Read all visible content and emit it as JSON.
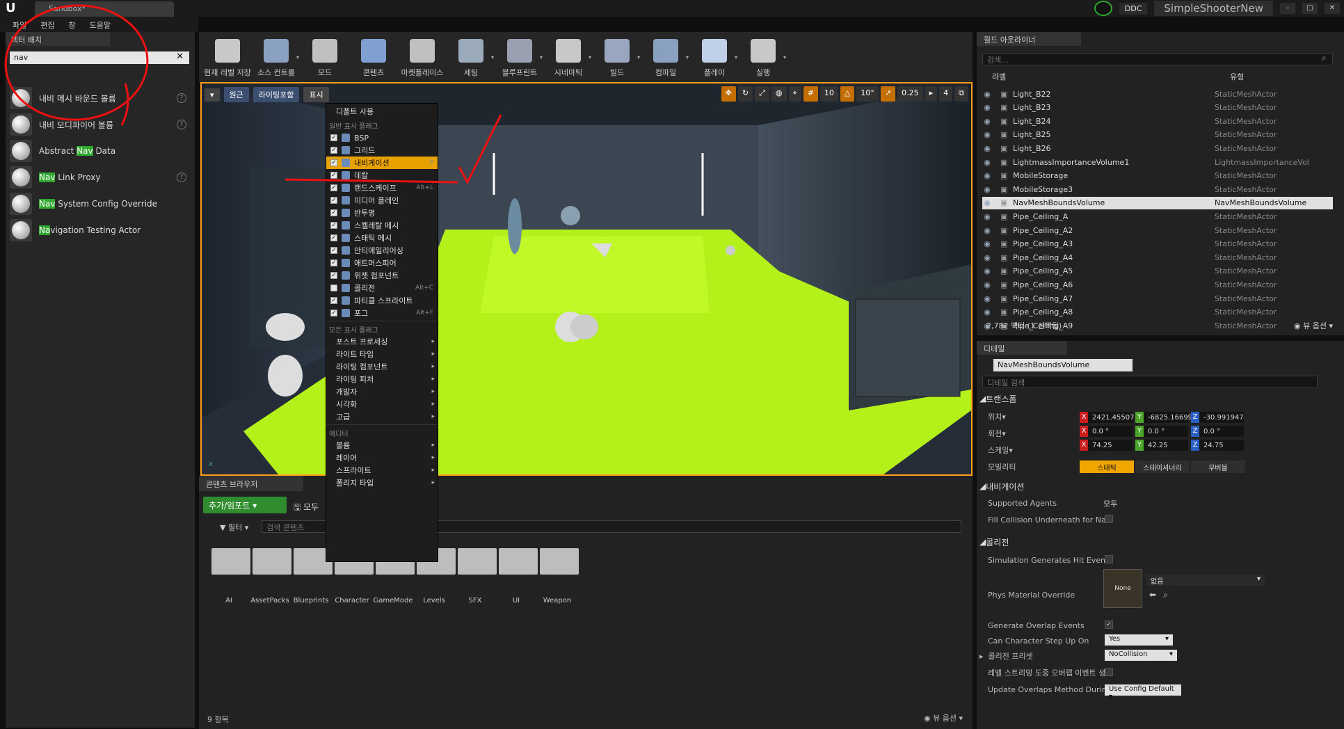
{
  "titlebar": {
    "tab": "Sandbox*",
    "ddc": "DDC",
    "project": "SimpleShooterNew"
  },
  "menu": [
    "파일",
    "편집",
    "창",
    "도움말"
  ],
  "place": {
    "tab": "액터 배치",
    "search_value": "nav",
    "items": [
      {
        "pre": "내비 메시 바운드 볼륨",
        "hl": "",
        "post": "",
        "help": true
      },
      {
        "pre": "내비 모디파이어 볼륨",
        "hl": "",
        "post": "",
        "help": true
      },
      {
        "pre": "Abstract ",
        "hl": "Nav",
        "post": " Data",
        "help": false
      },
      {
        "pre": "",
        "hl": "Nav",
        "post": " Link Proxy",
        "help": true
      },
      {
        "pre": "",
        "hl": "Nav",
        "post": " System Config Override",
        "help": false
      },
      {
        "pre": "",
        "hl": "Na",
        "post": "vigation Testing Actor",
        "help": false
      }
    ]
  },
  "toolbar": [
    "현재 레벨 저장",
    "소스 컨트롤",
    "모드",
    "콘텐츠",
    "마켓플레이스",
    "세팅",
    "블루프린트",
    "시네마틱",
    "빌드",
    "컴파일",
    "플레이",
    "실행"
  ],
  "viewport": {
    "btn_persp": "원근",
    "btn_lit": "라이팅포함",
    "btn_show": "표시",
    "grid": "10",
    "rot": "10°",
    "scale": "0.25",
    "cam": "4",
    "show_menu": {
      "use_defaults": "디폴트 사용",
      "common_header": "일반 표시 플래그",
      "common": [
        {
          "label": "BSP",
          "checked": true,
          "shortcut": ""
        },
        {
          "label": "그리드",
          "checked": true,
          "shortcut": ""
        },
        {
          "label": "내비게이션",
          "checked": true,
          "shortcut": "P",
          "selected": true
        },
        {
          "label": "데칼",
          "checked": true,
          "shortcut": ""
        },
        {
          "label": "랜드스케이프",
          "checked": true,
          "shortcut": "Alt+L"
        },
        {
          "label": "미디어 플레인",
          "checked": true,
          "shortcut": ""
        },
        {
          "label": "반투명",
          "checked": true,
          "shortcut": ""
        },
        {
          "label": "스켈레탈 메시",
          "checked": true,
          "shortcut": ""
        },
        {
          "label": "스태틱 메시",
          "checked": true,
          "shortcut": ""
        },
        {
          "label": "안티에일리어싱",
          "checked": true,
          "shortcut": ""
        },
        {
          "label": "애트머스피어",
          "checked": true,
          "shortcut": ""
        },
        {
          "label": "위젯 컴포넌트",
          "checked": true,
          "shortcut": ""
        },
        {
          "label": "콜리전",
          "checked": false,
          "shortcut": "Alt+C"
        },
        {
          "label": "파티클 스프라이트",
          "checked": true,
          "shortcut": ""
        },
        {
          "label": "포그",
          "checked": true,
          "shortcut": "Alt+F"
        }
      ],
      "all_header": "모든 표시 플래그",
      "all": [
        "포스트 프로세싱",
        "라이트 타입",
        "라이팅 컴포넌트",
        "라이팅 피처",
        "개발자",
        "시각화",
        "고급"
      ],
      "editor_header": "에디터",
      "editor": [
        "볼륨",
        "레이어",
        "스프라이트",
        "폴리지 타입"
      ]
    }
  },
  "content_browser": {
    "tab": "콘텐츠 브라우저",
    "add": "추가/임포트",
    "save_all": "모두",
    "filter": "필터",
    "search_placeholder": "검색 콘텐츠",
    "folders": [
      "AI",
      "AssetPacks",
      "Blueprints",
      "Character",
      "GameMode",
      "Levels",
      "SFX",
      "UI",
      "Weapon"
    ],
    "count": "9 항목",
    "view_options": "뷰 옵션"
  },
  "outliner": {
    "tab": "월드 아웃라이너",
    "search_placeholder": "검색...",
    "col_label": "라벨",
    "col_type": "유형",
    "rows": [
      {
        "name": "Light_B22",
        "type": "StaticMeshActor"
      },
      {
        "name": "Light_B23",
        "type": "StaticMeshActor"
      },
      {
        "name": "Light_B24",
        "type": "StaticMeshActor"
      },
      {
        "name": "Light_B25",
        "type": "StaticMeshActor"
      },
      {
        "name": "Light_B26",
        "type": "StaticMeshActor"
      },
      {
        "name": "LightmassImportanceVolume1",
        "type": "LightmassImportanceVol"
      },
      {
        "name": "MobileStorage",
        "type": "StaticMeshActor"
      },
      {
        "name": "MobileStorage3",
        "type": "StaticMeshActor"
      },
      {
        "name": "NavMeshBoundsVolume",
        "type": "NavMeshBoundsVolume",
        "selected": true
      },
      {
        "name": "Pipe_Ceiling_A",
        "type": "StaticMeshActor"
      },
      {
        "name": "Pipe_Ceiling_A2",
        "type": "StaticMeshActor"
      },
      {
        "name": "Pipe_Ceiling_A3",
        "type": "StaticMeshActor"
      },
      {
        "name": "Pipe_Ceiling_A4",
        "type": "StaticMeshActor"
      },
      {
        "name": "Pipe_Ceiling_A5",
        "type": "StaticMeshActor"
      },
      {
        "name": "Pipe_Ceiling_A6",
        "type": "StaticMeshActor"
      },
      {
        "name": "Pipe_Ceiling_A7",
        "type": "StaticMeshActor"
      },
      {
        "name": "Pipe_Ceiling_A8",
        "type": "StaticMeshActor"
      },
      {
        "name": "Pipe_Ceiling_A9",
        "type": "StaticMeshActor"
      }
    ],
    "count": "2,782 액터 (1 선택됨)",
    "view_options": "뷰 옵션"
  },
  "details": {
    "tab": "디테일",
    "name": "NavMeshBoundsVolume",
    "search_placeholder": "디테일 검색",
    "transform": "트랜스폼",
    "location_label": "위치",
    "rotation_label": "회전",
    "scale_label": "스케일",
    "mobility_label": "모빌리티",
    "loc": [
      "2421.45507",
      "-6825.16699",
      "-30.991947"
    ],
    "rot": [
      "0.0 °",
      "0.0 °",
      "0.0 °"
    ],
    "scale": [
      "74.25",
      "42.25",
      "24.75"
    ],
    "mobility": [
      "스태틱",
      "스테이셔너리",
      "무버블"
    ],
    "nav_section": "내비게이션",
    "supported_agents_label": "Supported Agents",
    "supported_agents_value": "모두",
    "fill_collision_label": "Fill Collision Underneath for Nav",
    "collision_section": "콜리전",
    "sim_hit_label": "Simulation Generates Hit Events",
    "phys_mat_label": "Phys Material Override",
    "phys_thumb": "None",
    "phys_value": "없음",
    "overlap_label": "Generate Overlap Events",
    "step_label": "Can Character Step Up On",
    "step_value": "Yes",
    "preset_label": "콜리전 프리셋",
    "preset_value": "NoCollision",
    "level_stream_label": "레벨 스트리밍 도중 오버랩 이벤트 생",
    "update_overlaps_label": "Update Overlaps Method During",
    "update_overlaps_value": "Use Config Default"
  }
}
